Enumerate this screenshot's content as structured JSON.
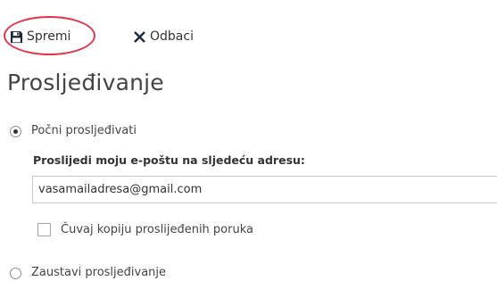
{
  "toolbar": {
    "save_label": "Spremi",
    "discard_label": "Odbaci",
    "save_icon": "floppy-disk-icon",
    "discard_icon": "close-x-icon",
    "highlight_color": "#e0354a"
  },
  "page": {
    "title": "Prosljeđivanje"
  },
  "forwarding": {
    "start_option": {
      "label": "Počni prosljeđivati",
      "selected": true
    },
    "address_label": "Proslijedi moju e-poštu na sljedeću adresu:",
    "address_value": "vasamailadresa@gmail.com",
    "keep_copy": {
      "label": "Čuvaj kopiju proslijeđenih poruka",
      "checked": false
    },
    "stop_option": {
      "label": "Zaustavi prosljeđivanje",
      "selected": false
    }
  }
}
